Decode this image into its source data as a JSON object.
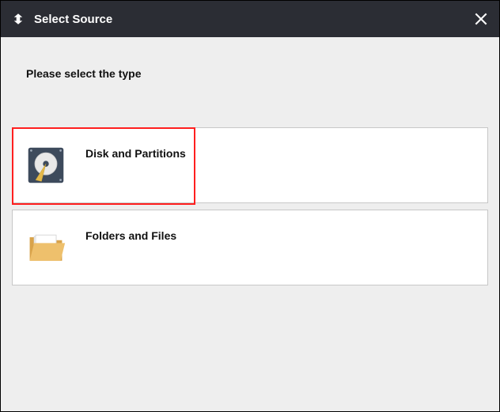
{
  "header": {
    "title": "Select Source"
  },
  "prompt": "Please select the type",
  "options": {
    "disk": {
      "label": "Disk and Partitions"
    },
    "folders": {
      "label": "Folders and Files"
    }
  }
}
